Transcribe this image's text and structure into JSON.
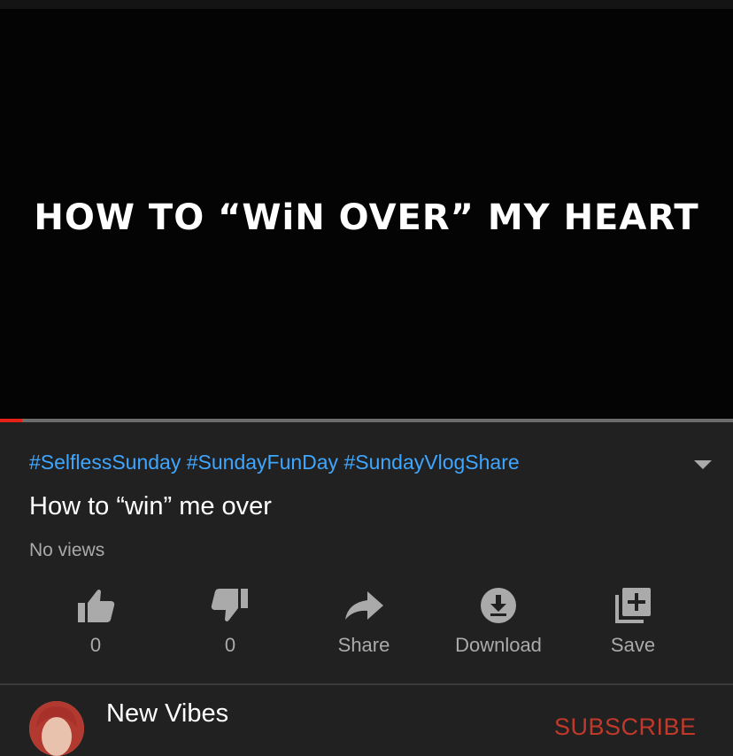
{
  "video": {
    "overlay_text": "HOW TO “WiN OVER” MY HEART",
    "progress": 0.03
  },
  "details": {
    "hashtags": "#SelflessSunday #SundayFunDay #SundayVlogShare",
    "title": "How to “win” me over",
    "views": "No views"
  },
  "actions": [
    {
      "label": "0",
      "icon": "thumbs-up-icon"
    },
    {
      "label": "0",
      "icon": "thumbs-down-icon"
    },
    {
      "label": "Share",
      "icon": "share-icon"
    },
    {
      "label": "Download",
      "icon": "download-icon"
    },
    {
      "label": "Save",
      "icon": "save-playlist-icon"
    }
  ],
  "channel": {
    "name": "New Vibes",
    "subscribe_label": "SUBSCRIBE"
  },
  "colors": {
    "link": "#3ea6ff",
    "progress": "#e62117",
    "subscribe": "#c0392b",
    "background": "#212121"
  }
}
